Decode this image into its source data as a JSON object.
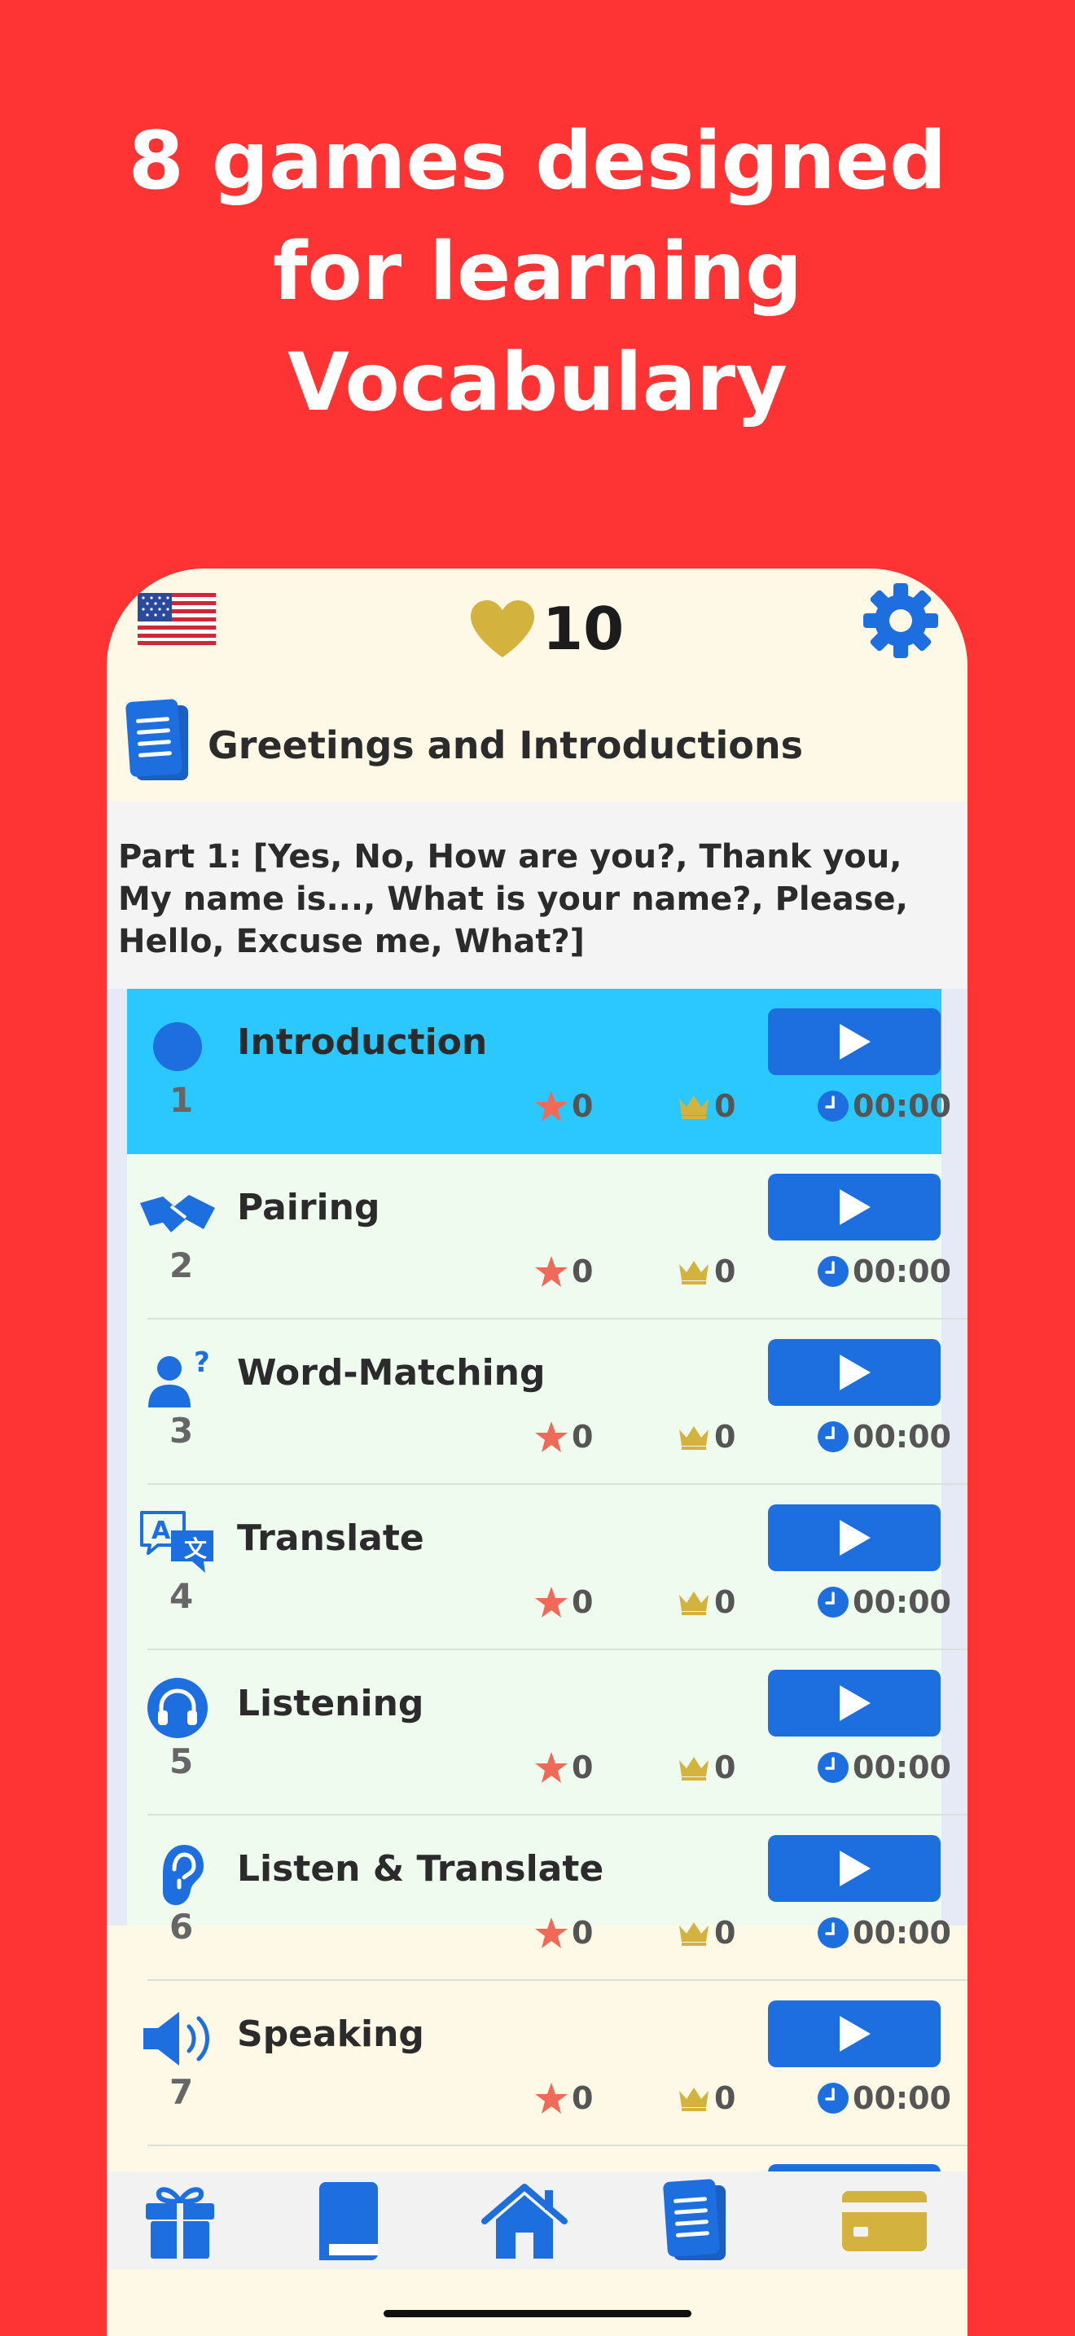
{
  "headline": {
    "line1": "8 games designed",
    "line2": "for learning",
    "line3": "Vocabulary"
  },
  "topbar": {
    "flag_icon": "us-flag-icon",
    "lives_count": "10",
    "settings_icon": "gear-icon"
  },
  "section": {
    "title": "Greetings and Introductions"
  },
  "part": {
    "text": "Part 1: [Yes, No, How are you?, Thank you, My name is..., What is your name?, Please, Hello, Excuse me, What?]"
  },
  "games": [
    {
      "title": "Introduction",
      "number": "1",
      "stars": "0",
      "crowns": "0",
      "time": "00:00",
      "icon": "circle-icon",
      "active": true
    },
    {
      "title": "Pairing",
      "number": "2",
      "stars": "0",
      "crowns": "0",
      "time": "00:00",
      "icon": "handshake-icon",
      "active": false
    },
    {
      "title": "Word-Matching",
      "number": "3",
      "stars": "0",
      "crowns": "0",
      "time": "00:00",
      "icon": "person-question-icon",
      "active": false
    },
    {
      "title": "Translate",
      "number": "4",
      "stars": "0",
      "crowns": "0",
      "time": "00:00",
      "icon": "translate-icon",
      "active": false
    },
    {
      "title": "Listening",
      "number": "5",
      "stars": "0",
      "crowns": "0",
      "time": "00:00",
      "icon": "headphones-icon",
      "active": false
    },
    {
      "title": "Listen & Translate",
      "number": "6",
      "stars": "0",
      "crowns": "0",
      "time": "00:00",
      "icon": "ear-icon",
      "active": false
    },
    {
      "title": "Speaking",
      "number": "7",
      "stars": "0",
      "crowns": "0",
      "time": "00:00",
      "icon": "speaker-icon",
      "active": false
    }
  ],
  "tabbar": [
    "gift-icon",
    "book-icon",
    "home-icon",
    "document-icon",
    "card-icon"
  ],
  "colors": {
    "background": "#fe3333",
    "primary": "#1d6fe0",
    "active_row": "#2ac8ff",
    "gold": "#d3b23e",
    "star": "#f06a5a",
    "cream": "#fef8e6"
  }
}
